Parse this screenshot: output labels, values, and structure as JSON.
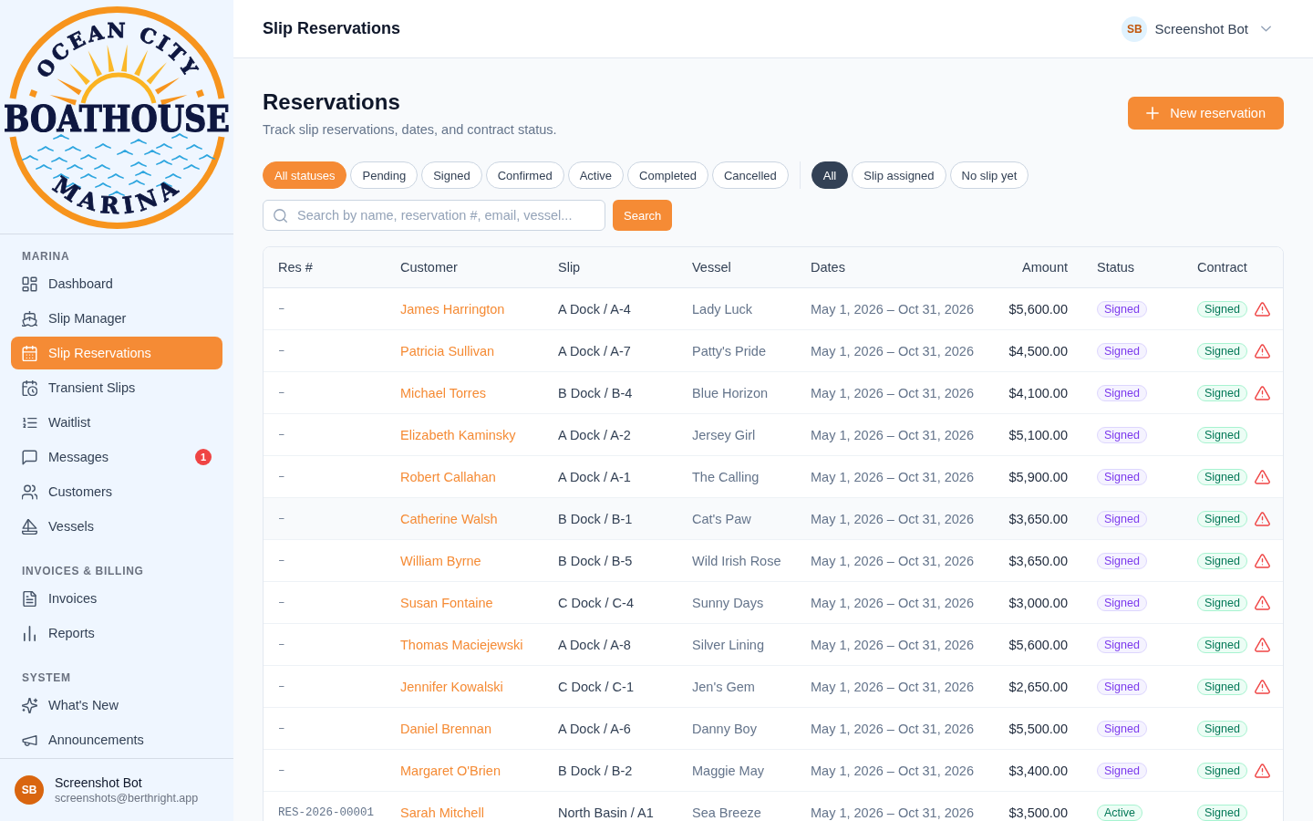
{
  "sidebar": {
    "logo": {
      "arc_top": "OCEAN CITY",
      "center": "BOATHOUSE",
      "arc_bottom": "MARINA"
    },
    "sections": [
      {
        "title": "MARINA",
        "items": [
          {
            "label": "Dashboard",
            "selected": false
          },
          {
            "label": "Slip Manager",
            "selected": false
          },
          {
            "label": "Slip Reservations",
            "selected": true
          },
          {
            "label": "Transient Slips",
            "selected": false
          },
          {
            "label": "Waitlist",
            "selected": false
          },
          {
            "label": "Messages",
            "selected": false,
            "badge": "1"
          },
          {
            "label": "Customers",
            "selected": false
          },
          {
            "label": "Vessels",
            "selected": false
          }
        ]
      },
      {
        "title": "INVOICES & BILLING",
        "items": [
          {
            "label": "Invoices",
            "selected": false
          },
          {
            "label": "Reports",
            "selected": false
          }
        ]
      },
      {
        "title": "SYSTEM",
        "items": [
          {
            "label": "What's New",
            "selected": false
          },
          {
            "label": "Announcements",
            "selected": false
          }
        ]
      }
    ],
    "user": {
      "initials": "SB",
      "name": "Screenshot Bot",
      "email": "screenshots@berthright.app"
    }
  },
  "header": {
    "title": "Slip Reservations",
    "user": {
      "initials": "SB",
      "name": "Screenshot Bot"
    }
  },
  "page": {
    "title": "Reservations",
    "subtitle": "Track slip reservations, dates, and contract status.",
    "primary_action": "New reservation"
  },
  "filters": {
    "status": [
      {
        "label": "All statuses",
        "selected": true
      },
      {
        "label": "Pending",
        "selected": false
      },
      {
        "label": "Signed",
        "selected": false
      },
      {
        "label": "Confirmed",
        "selected": false
      },
      {
        "label": "Active",
        "selected": false
      },
      {
        "label": "Completed",
        "selected": false
      },
      {
        "label": "Cancelled",
        "selected": false
      }
    ],
    "slip": [
      {
        "label": "All",
        "selected": true
      },
      {
        "label": "Slip assigned",
        "selected": false
      },
      {
        "label": "No slip yet",
        "selected": false
      }
    ]
  },
  "search": {
    "placeholder": "Search by name, reservation #, email, vessel...",
    "button": "Search"
  },
  "table": {
    "columns": [
      "Res #",
      "Customer",
      "Slip",
      "Vessel",
      "Dates",
      "Amount",
      "Status",
      "Contract"
    ],
    "rows": [
      {
        "res_no": "–",
        "customer": "James Harrington",
        "slip": "A Dock / A-4",
        "vessel": "Lady Luck",
        "dates": "May 1, 2026 – Oct 31, 2026",
        "amount": "$5,600.00",
        "status": {
          "label": "Signed",
          "kind": "signed"
        },
        "contract": {
          "label": "Signed",
          "kind": "signed"
        },
        "warning": true,
        "highlighted": false
      },
      {
        "res_no": "–",
        "customer": "Patricia Sullivan",
        "slip": "A Dock / A-7",
        "vessel": "Patty's Pride",
        "dates": "May 1, 2026 – Oct 31, 2026",
        "amount": "$4,500.00",
        "status": {
          "label": "Signed",
          "kind": "signed"
        },
        "contract": {
          "label": "Signed",
          "kind": "signed"
        },
        "warning": true,
        "highlighted": false
      },
      {
        "res_no": "–",
        "customer": "Michael Torres",
        "slip": "B Dock / B-4",
        "vessel": "Blue Horizon",
        "dates": "May 1, 2026 – Oct 31, 2026",
        "amount": "$4,100.00",
        "status": {
          "label": "Signed",
          "kind": "signed"
        },
        "contract": {
          "label": "Signed",
          "kind": "signed"
        },
        "warning": true,
        "highlighted": false
      },
      {
        "res_no": "–",
        "customer": "Elizabeth Kaminsky",
        "slip": "A Dock / A-2",
        "vessel": "Jersey Girl",
        "dates": "May 1, 2026 – Oct 31, 2026",
        "amount": "$5,100.00",
        "status": {
          "label": "Signed",
          "kind": "signed"
        },
        "contract": {
          "label": "Signed",
          "kind": "signed"
        },
        "warning": false,
        "highlighted": false
      },
      {
        "res_no": "–",
        "customer": "Robert Callahan",
        "slip": "A Dock / A-1",
        "vessel": "The Calling",
        "dates": "May 1, 2026 – Oct 31, 2026",
        "amount": "$5,900.00",
        "status": {
          "label": "Signed",
          "kind": "signed"
        },
        "contract": {
          "label": "Signed",
          "kind": "signed"
        },
        "warning": true,
        "highlighted": false
      },
      {
        "res_no": "–",
        "customer": "Catherine Walsh",
        "slip": "B Dock / B-1",
        "vessel": "Cat's Paw",
        "dates": "May 1, 2026 – Oct 31, 2026",
        "amount": "$3,650.00",
        "status": {
          "label": "Signed",
          "kind": "signed"
        },
        "contract": {
          "label": "Signed",
          "kind": "signed"
        },
        "warning": true,
        "highlighted": true
      },
      {
        "res_no": "–",
        "customer": "William Byrne",
        "slip": "B Dock / B-5",
        "vessel": "Wild Irish Rose",
        "dates": "May 1, 2026 – Oct 31, 2026",
        "amount": "$3,650.00",
        "status": {
          "label": "Signed",
          "kind": "signed"
        },
        "contract": {
          "label": "Signed",
          "kind": "signed"
        },
        "warning": true,
        "highlighted": false
      },
      {
        "res_no": "–",
        "customer": "Susan Fontaine",
        "slip": "C Dock / C-4",
        "vessel": "Sunny Days",
        "dates": "May 1, 2026 – Oct 31, 2026",
        "amount": "$3,000.00",
        "status": {
          "label": "Signed",
          "kind": "signed"
        },
        "contract": {
          "label": "Signed",
          "kind": "signed"
        },
        "warning": true,
        "highlighted": false
      },
      {
        "res_no": "–",
        "customer": "Thomas Maciejewski",
        "slip": "A Dock / A-8",
        "vessel": "Silver Lining",
        "dates": "May 1, 2026 – Oct 31, 2026",
        "amount": "$5,600.00",
        "status": {
          "label": "Signed",
          "kind": "signed"
        },
        "contract": {
          "label": "Signed",
          "kind": "signed"
        },
        "warning": true,
        "highlighted": false
      },
      {
        "res_no": "–",
        "customer": "Jennifer Kowalski",
        "slip": "C Dock / C-1",
        "vessel": "Jen's Gem",
        "dates": "May 1, 2026 – Oct 31, 2026",
        "amount": "$2,650.00",
        "status": {
          "label": "Signed",
          "kind": "signed"
        },
        "contract": {
          "label": "Signed",
          "kind": "signed"
        },
        "warning": true,
        "highlighted": false
      },
      {
        "res_no": "–",
        "customer": "Daniel Brennan",
        "slip": "A Dock / A-6",
        "vessel": "Danny Boy",
        "dates": "May 1, 2026 – Oct 31, 2026",
        "amount": "$5,500.00",
        "status": {
          "label": "Signed",
          "kind": "signed"
        },
        "contract": {
          "label": "Signed",
          "kind": "signed"
        },
        "warning": false,
        "highlighted": false
      },
      {
        "res_no": "–",
        "customer": "Margaret O'Brien",
        "slip": "B Dock / B-2",
        "vessel": "Maggie May",
        "dates": "May 1, 2026 – Oct 31, 2026",
        "amount": "$3,400.00",
        "status": {
          "label": "Signed",
          "kind": "signed"
        },
        "contract": {
          "label": "Signed",
          "kind": "signed"
        },
        "warning": true,
        "highlighted": false
      },
      {
        "res_no": "RES-2026-00001",
        "customer": "Sarah Mitchell",
        "slip": "North Basin / A1",
        "vessel": "Sea Breeze",
        "dates": "May 1, 2026 – Oct 31, 2026",
        "amount": "$3,500.00",
        "status": {
          "label": "Active",
          "kind": "active"
        },
        "contract": {
          "label": "Signed",
          "kind": "signed"
        },
        "warning": false,
        "highlighted": false
      }
    ]
  }
}
